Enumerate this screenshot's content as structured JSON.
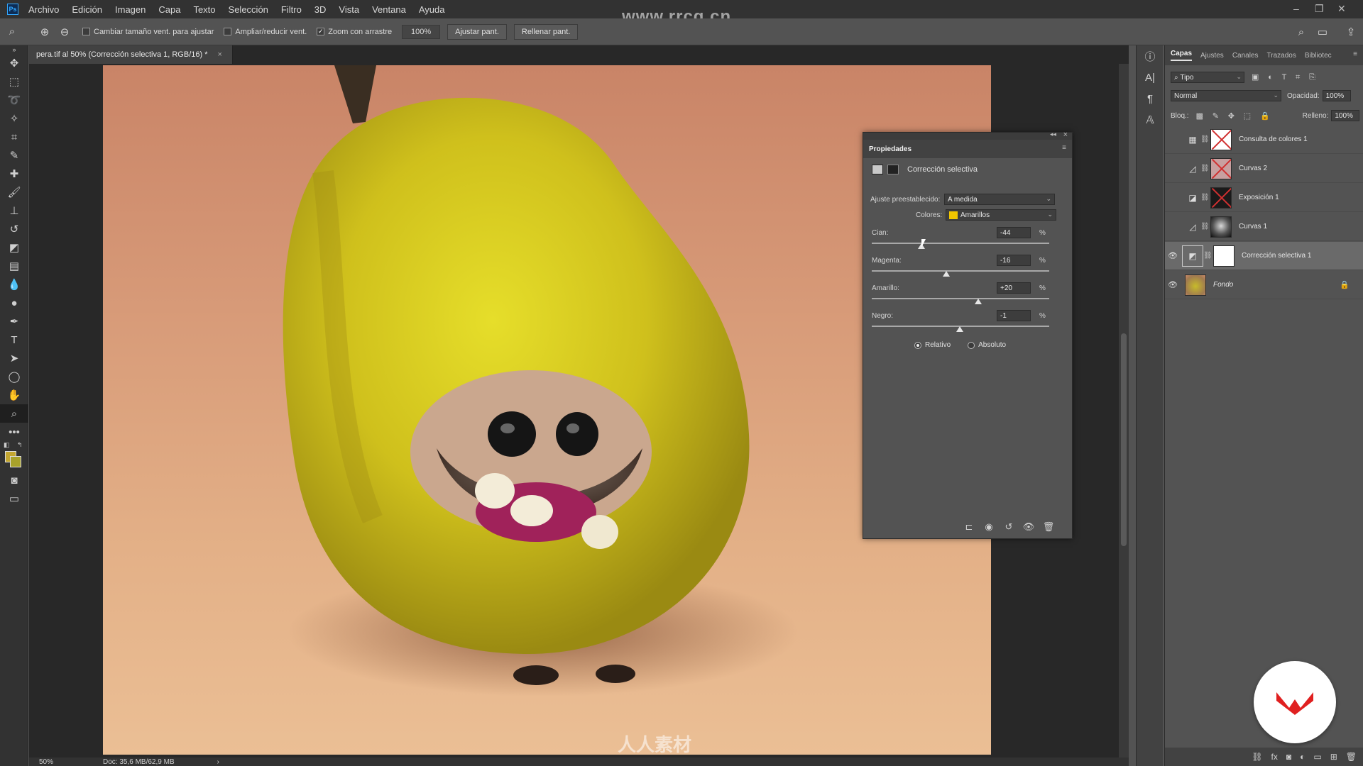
{
  "app": {
    "logo_text": "Ps",
    "watermark_top": "www.rrcg.cn",
    "watermark_bottom": "人人素材"
  },
  "menu": [
    "Archivo",
    "Edición",
    "Imagen",
    "Capa",
    "Texto",
    "Selección",
    "Filtro",
    "3D",
    "Vista",
    "Ventana",
    "Ayuda"
  ],
  "options": {
    "resize_windows_label": "Cambiar tamaño vent. para ajustar",
    "zoom_all_windows_label": "Ampliar/reducir vent.",
    "scrubby_zoom_label": "Zoom con arrastre",
    "zoom_value": "100%",
    "fit_screen_label": "Ajustar pant.",
    "fill_screen_label": "Rellenar pant."
  },
  "document": {
    "tab_title": "pera.tif al 50% (Corrección selectiva 1, RGB/16) *",
    "zoom": "50%",
    "doc_size": "Doc: 35,6 MB/62,9 MB"
  },
  "properties": {
    "panel_title": "Propiedades",
    "adjustment_name": "Corrección selectiva",
    "preset_label": "Ajuste preestablecido:",
    "preset_value": "A medida",
    "colors_label": "Colores:",
    "colors_value": "Amarillos",
    "colors_swatch": "#f2c600",
    "sliders": [
      {
        "label": "Cian:",
        "value": "-44",
        "percent": -44
      },
      {
        "label": "Magenta:",
        "value": "-16",
        "percent": -16
      },
      {
        "label": "Amarillo:",
        "value": "+20",
        "percent": 20
      },
      {
        "label": "Negro:",
        "value": "-1",
        "percent": -1
      }
    ],
    "pct_sign": "%",
    "method_relative": "Relativo",
    "method_absolute": "Absoluto",
    "method_selected": "Relativo"
  },
  "layers_panel": {
    "tabs": [
      "Capas",
      "Ajustes",
      "Canales",
      "Trazados",
      "Bibliotec"
    ],
    "active_tab": "Capas",
    "filter_kind": "Tipo",
    "blend_mode": "Normal",
    "opacity_label": "Opacidad:",
    "opacity_value": "100%",
    "lock_label": "Bloq.:",
    "fill_label": "Relleno:",
    "fill_value": "100%",
    "layers": [
      {
        "name": "Consulta de colores 1",
        "visible": false,
        "selected": false,
        "icon": "grid-icon"
      },
      {
        "name": "Curvas 2",
        "visible": false,
        "selected": false,
        "icon": "curves-icon"
      },
      {
        "name": "Exposición 1",
        "visible": false,
        "selected": false,
        "icon": "exposure-icon"
      },
      {
        "name": "Curvas 1",
        "visible": false,
        "selected": false,
        "icon": "curves-icon"
      },
      {
        "name": "Corrección selectiva 1",
        "visible": true,
        "selected": true,
        "icon": "selective-color-icon"
      },
      {
        "name": "Fondo",
        "visible": true,
        "selected": false,
        "icon": "image-icon",
        "locked": true
      }
    ]
  },
  "colors": {
    "foreground": "#c3a630",
    "background": "#a8a22b",
    "accent": "#31a8ff",
    "badge_red": "#e02020"
  }
}
